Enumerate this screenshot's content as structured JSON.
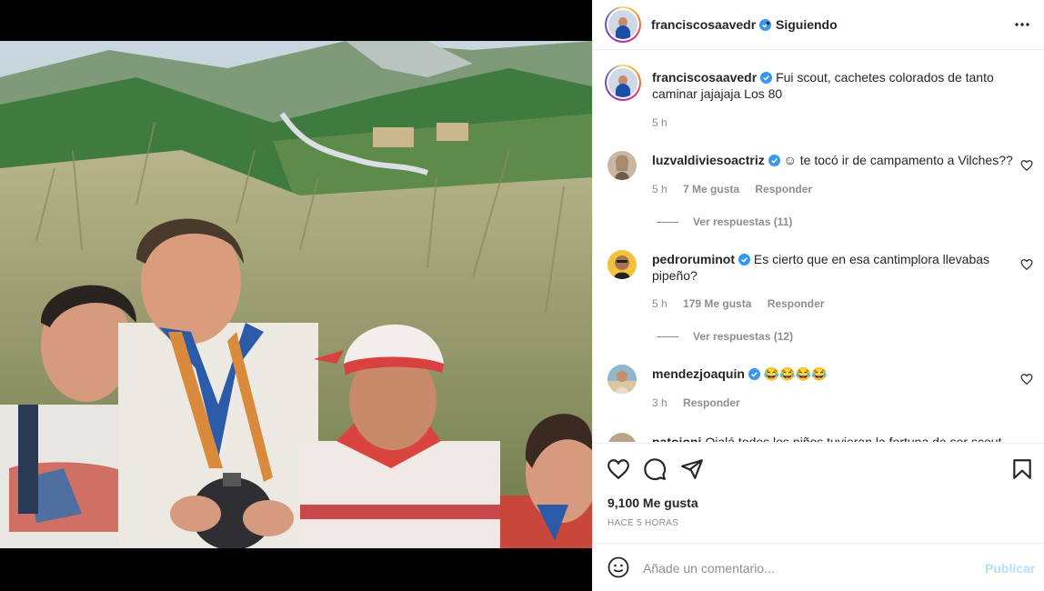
{
  "post": {
    "author": "franciscosaavedr",
    "follow_status": "Siguiendo",
    "separator": "•",
    "caption": "Fui scout, cachetes colorados de tanto caminar jajajaja Los 80",
    "caption_time": "5 h",
    "likes": "9,100 Me gusta",
    "posted": "HACE 5 HORAS"
  },
  "comments": [
    {
      "user": "luzvaldiviesoactriz",
      "verified": true,
      "text": "☺ te tocó ir de campamento a Vilches??",
      "time": "5 h",
      "likes": "7 Me gusta",
      "reply": "Responder",
      "view_replies": "Ver respuestas (11)"
    },
    {
      "user": "pedroruminot",
      "verified": true,
      "text": "Es cierto que en esa cantimplora llevabas pipeño?",
      "time": "5 h",
      "likes": "179 Me gusta",
      "reply": "Responder",
      "view_replies": "Ver respuestas (12)"
    },
    {
      "user": "mendezjoaquin",
      "verified": true,
      "text": "😂😂😂😂",
      "time": "3 h",
      "reply": "Responder"
    },
    {
      "user": "patoioni",
      "text": "Ojalá todos los niños tuvieran la fortuna de ser scout"
    }
  ],
  "composer": {
    "placeholder": "Añade un comentario...",
    "publish": "Publicar"
  },
  "icons": {
    "more": "more-options-icon",
    "like": "heart-icon",
    "comment": "comment-icon",
    "share": "share-icon",
    "save": "bookmark-icon",
    "emoji": "emoji-icon",
    "verified": "verified-badge-icon"
  },
  "colors": {
    "verified": "#3897f0",
    "publish_disabled": "#b2dffc",
    "muted": "#8e8e8e"
  }
}
